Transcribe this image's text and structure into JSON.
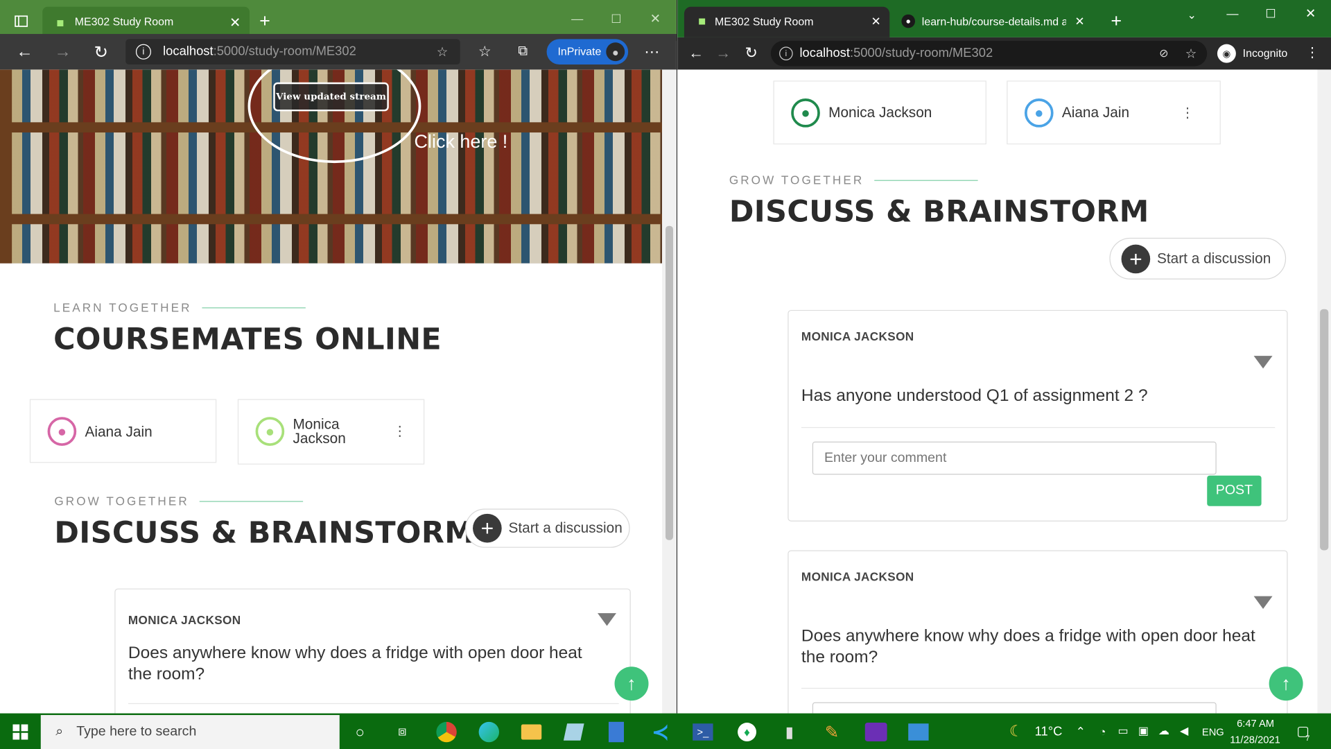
{
  "left_window": {
    "tab_title": "ME302 Study Room",
    "url_host": "localhost",
    "url_rest": ":5000/study-room/ME302",
    "inprivate_label": "InPrivate",
    "hero": {
      "stream_button": "View updated stream",
      "click_hint": "Click here !"
    },
    "coursemates": {
      "eyebrow": "LEARN TOGETHER",
      "heading": "COURSEMATES ONLINE",
      "members": [
        "Aiana Jain",
        "Monica Jackson"
      ]
    },
    "discuss": {
      "eyebrow": "GROW TOGETHER",
      "heading": "DISCUSS & BRAINSTORM",
      "start_label": "Start a discussion"
    },
    "posts": [
      {
        "author": "MONICA JACKSON",
        "question": "Does anywhere know why does a fridge with open door heat the room?"
      }
    ]
  },
  "right_window": {
    "tabs": [
      "ME302 Study Room",
      "learn-hub/course-details.md at m"
    ],
    "url_host": "localhost",
    "url_rest": ":5000/study-room/ME302",
    "incognito_label": "Incognito",
    "members": [
      "Monica Jackson",
      "Aiana Jain"
    ],
    "discuss": {
      "eyebrow": "GROW TOGETHER",
      "heading": "DISCUSS & BRAINSTORM",
      "start_label": "Start a discussion"
    },
    "posts": [
      {
        "author": "MONICA JACKSON",
        "question": "Has anyone understood Q1 of assignment 2 ?",
        "comment_placeholder": "Enter your comment",
        "post_label": "POST"
      },
      {
        "author": "MONICA JACKSON",
        "question": "Does anywhere know why does a fridge with open door heat the room?"
      }
    ]
  },
  "taskbar": {
    "search_placeholder": "Type here to search",
    "weather": "11°C",
    "lang": "ENG",
    "time": "6:47 AM",
    "date": "11/28/2021",
    "notif_count": "7"
  },
  "colors": {
    "edge_tabbar": "#4f8a3c",
    "chrome_tabbar": "#1e6b25",
    "accent_green": "#3fc37b",
    "inprivate_blue": "#1f6ad1",
    "taskbar": "#0a6b0f"
  }
}
